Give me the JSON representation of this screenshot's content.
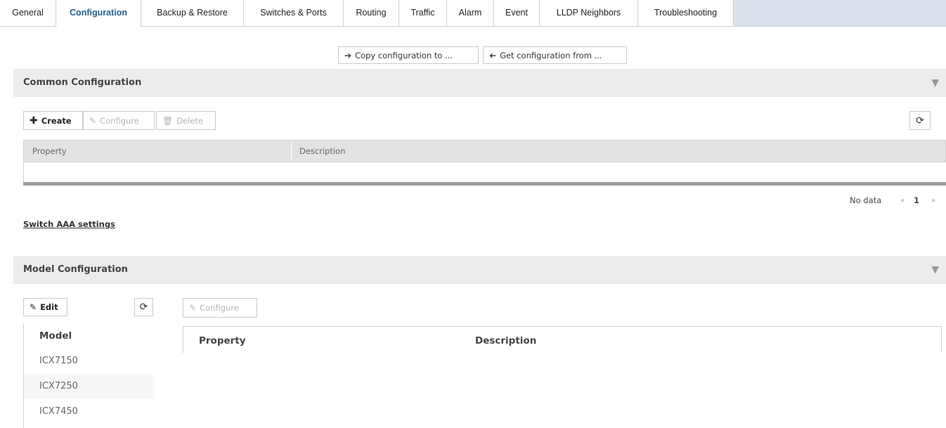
{
  "tabs": [
    {
      "label": "General",
      "active": false
    },
    {
      "label": "Configuration",
      "active": true
    },
    {
      "label": "Backup & Restore",
      "active": false
    },
    {
      "label": "Switches & Ports",
      "active": false
    },
    {
      "label": "Routing",
      "active": false
    },
    {
      "label": "Traffic",
      "active": false
    },
    {
      "label": "Alarm",
      "active": false
    },
    {
      "label": "Event",
      "active": false
    },
    {
      "label": "LLDP Neighbors",
      "active": false
    },
    {
      "label": "Troubleshooting",
      "active": false
    }
  ],
  "top_actions": {
    "copy_label": "Copy configuration to ...",
    "get_label": "Get configuration from ..."
  },
  "common": {
    "title": "Common Configuration",
    "create_label": "Create",
    "configure_label": "Configure",
    "delete_label": "Delete",
    "columns": [
      "Property",
      "Description"
    ],
    "rows": [],
    "empty_text": "No data",
    "page_prev": "«",
    "page_current": "1",
    "page_next": "»"
  },
  "aaa_link": "Switch AAA settings",
  "model": {
    "title": "Model Configuration",
    "edit_label": "Edit",
    "configure_label": "Configure",
    "list_header": "Model",
    "models": [
      "ICX7150",
      "ICX7250",
      "ICX7450"
    ],
    "columns": [
      "Property",
      "Description"
    ]
  },
  "colors": {
    "active_tab": "#1f5f8e",
    "tabbar_fill": "#d9e1ea",
    "section_bg": "#ececec"
  }
}
